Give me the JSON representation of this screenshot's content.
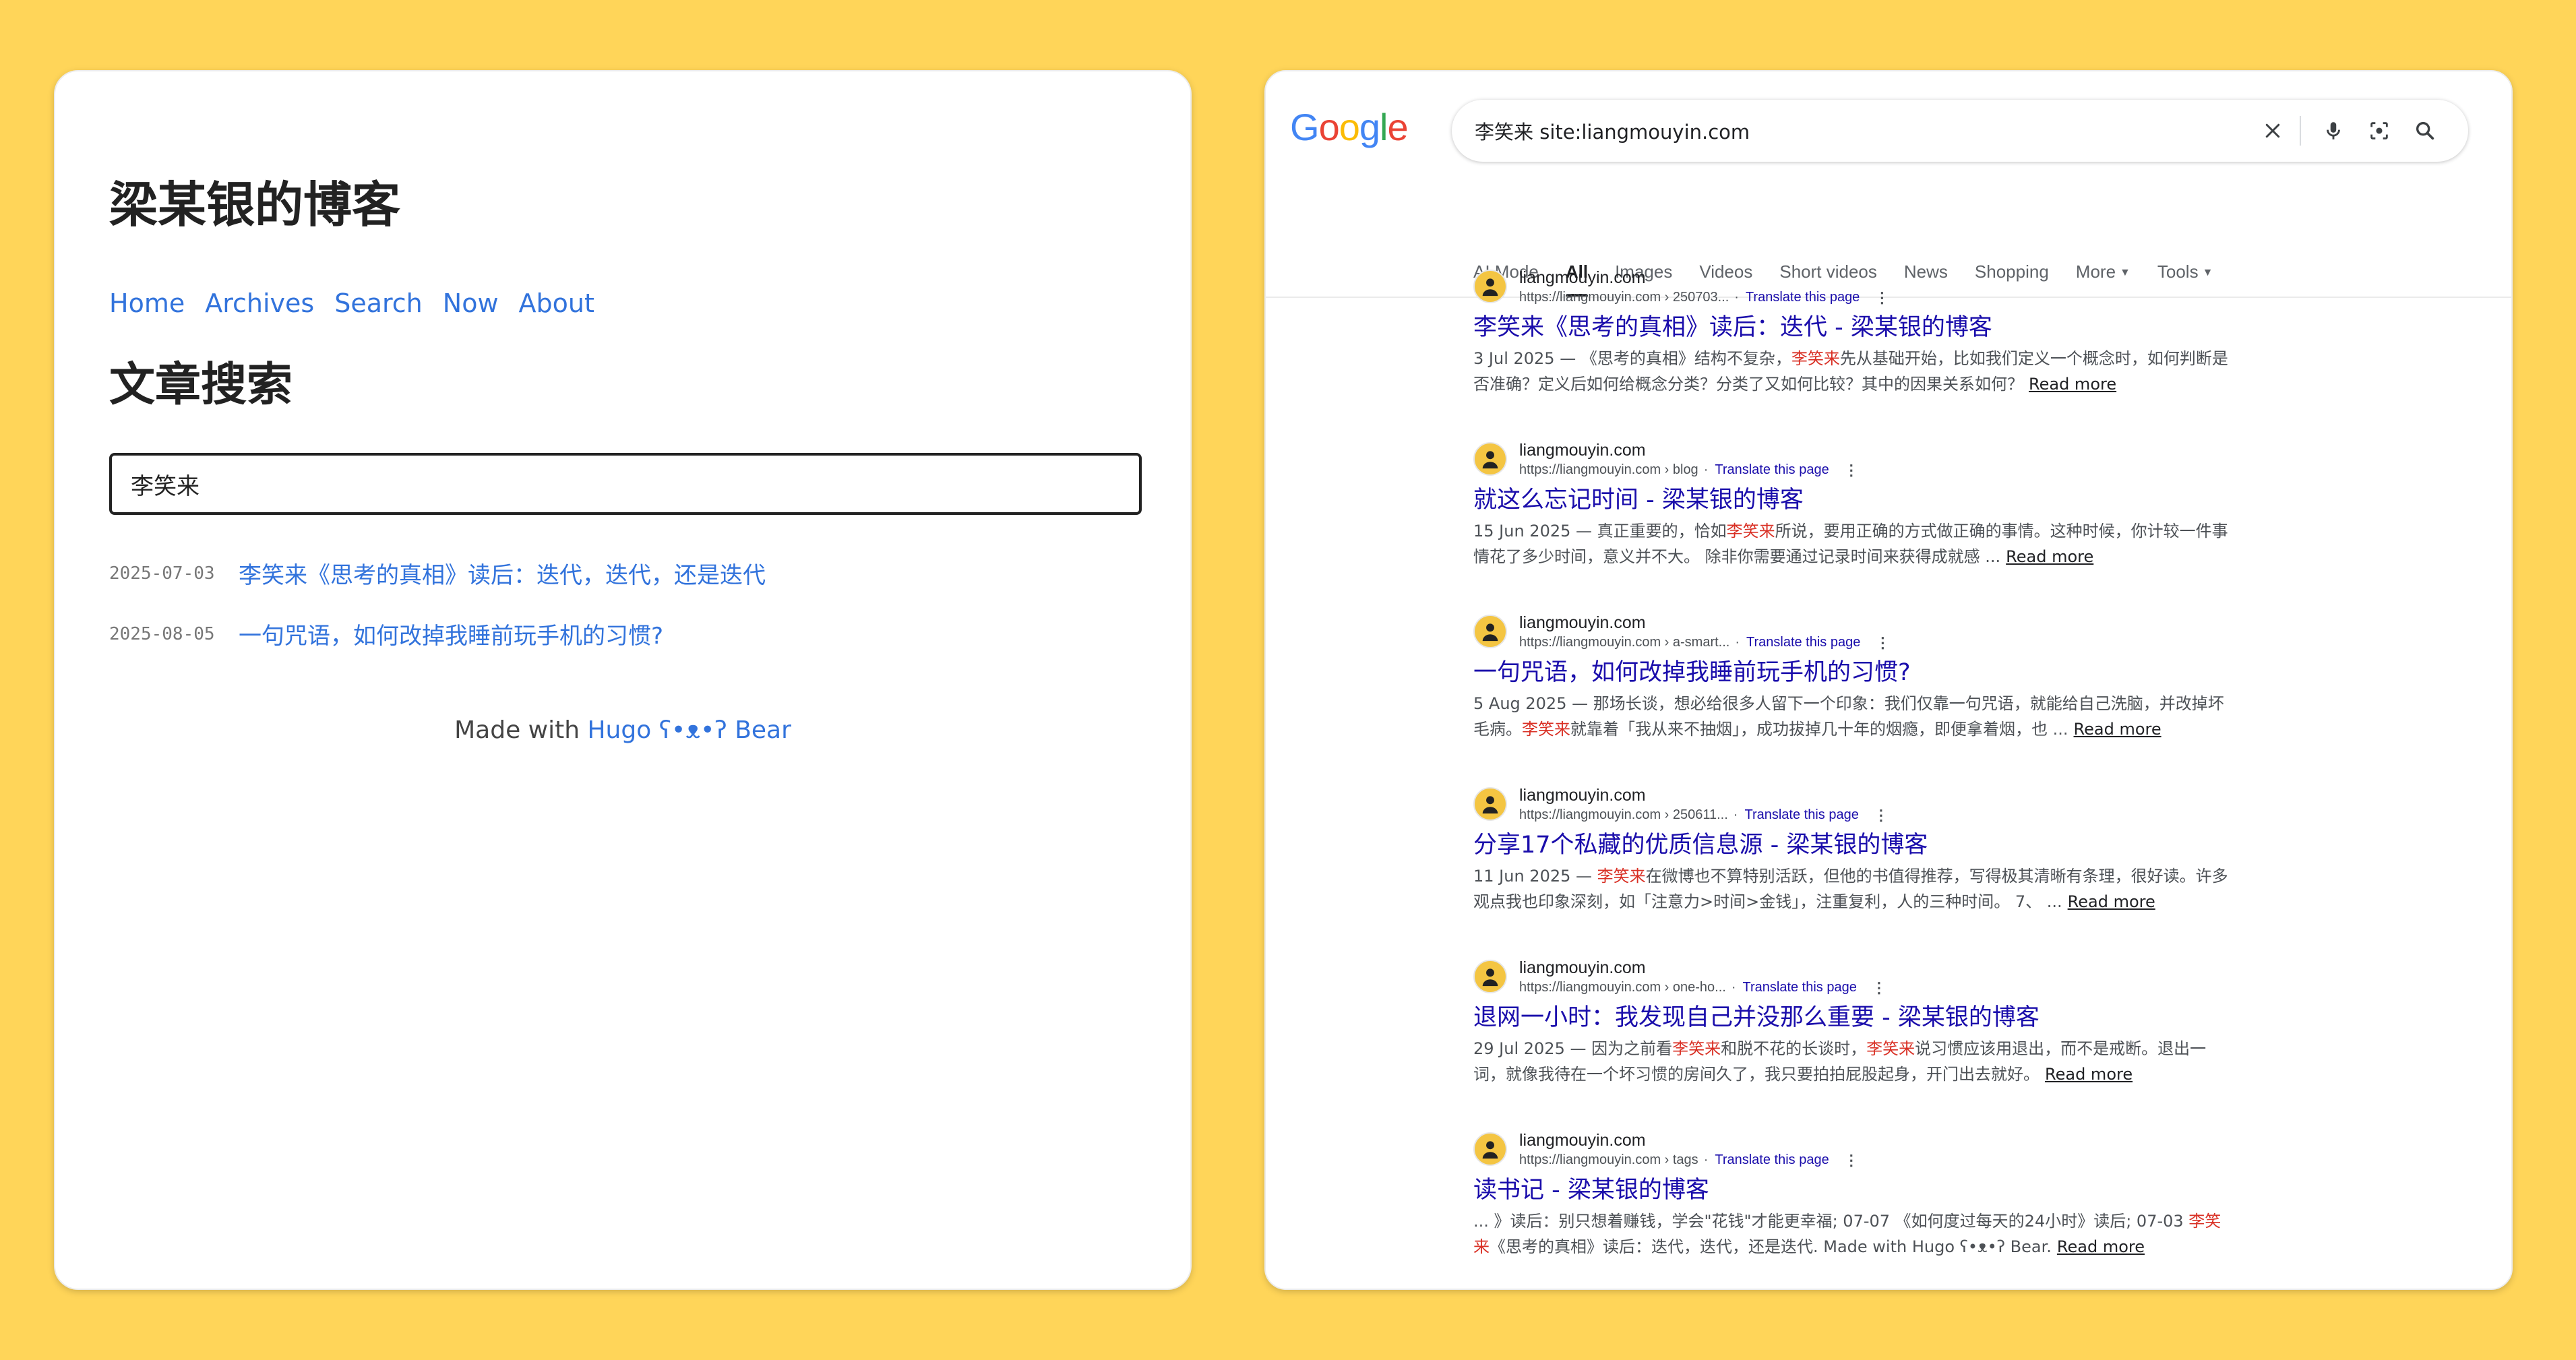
{
  "blog": {
    "title": "梁某银的博客",
    "nav": [
      "Home",
      "Archives",
      "Search",
      "Now",
      "About"
    ],
    "heading": "文章搜索",
    "search_value": "李笑来",
    "posts": [
      {
        "date": "2025-07-03",
        "title": "李笑来《思考的真相》读后：迭代，迭代，还是迭代"
      },
      {
        "date": "2025-08-05",
        "title": "一句咒语，如何改掉我睡前玩手机的习惯?"
      }
    ],
    "footer_prefix": "Made with ",
    "footer_link": "Hugo ʕ•ᴥ•ʔ Bear"
  },
  "google": {
    "logo": "Google",
    "query": "李笑来 site:liangmouyin.com",
    "tabs": [
      "AI Mode",
      "All",
      "Images",
      "Videos",
      "Short videos",
      "News",
      "Shopping",
      "More",
      "Tools"
    ],
    "active_tab": "All",
    "translate_label": "Translate this page",
    "read_more": "Read more",
    "results": [
      {
        "site": "liangmouyin.com",
        "url": "https://liangmouyin.com › 250703...",
        "title": "李笑来《思考的真相》读后：迭代 - 梁某银的博客",
        "s1": "3 Jul 2025 — 《思考的真相》结构不复杂，",
        "em1": "李笑来",
        "s2": "先从基础开始，比如我们定义一个概念时，如何判断是否准确？定义后如何给概念分类？分类了又如何比较？其中的因果关系如何？",
        "em2": "",
        "s3": ""
      },
      {
        "site": "liangmouyin.com",
        "url": "https://liangmouyin.com › blog",
        "title": "就这么忘记时间 - 梁某银的博客",
        "s1": "15 Jun 2025 — 真正重要的，恰如",
        "em1": "李笑来",
        "s2": "所说，要用正确的方式做正确的事情。这种时候，你计较一件事情花了多少时间，意义并不大。 除非你需要通过记录时间来获得成就感 ...",
        "em2": "",
        "s3": ""
      },
      {
        "site": "liangmouyin.com",
        "url": "https://liangmouyin.com › a-smart...",
        "title": "一句咒语，如何改掉我睡前玩手机的习惯?",
        "s1": "5 Aug 2025 — 那场长谈，想必给很多人留下一个印象：我们仅靠一句咒语，就能给自己洗脑，并改掉坏毛病。",
        "em1": "李笑来",
        "s2": "就靠着「我从来不抽烟」，成功拔掉几十年的烟瘾，即便拿着烟，也 ...",
        "em2": "",
        "s3": ""
      },
      {
        "site": "liangmouyin.com",
        "url": "https://liangmouyin.com › 250611...",
        "title": "分享17个私藏的优质信息源 - 梁某银的博客",
        "s1": "11 Jun 2025 — ",
        "em1": "李笑来",
        "s2": "在微博也不算特别活跃，但他的书值得推荐，写得极其清晰有条理，很好读。许多观点我也印象深刻，如「注意力>时间>金钱」，注重复利，人的三种时间。 7、 ...",
        "em2": "",
        "s3": ""
      },
      {
        "site": "liangmouyin.com",
        "url": "https://liangmouyin.com › one-ho...",
        "title": "退网一小时：我发现自己并没那么重要 - 梁某银的博客",
        "s1": "29 Jul 2025 — 因为之前看",
        "em1": "李笑来",
        "s2": "和脱不花的长谈时，",
        "em2": "李笑来",
        "s3": "说习惯应该用退出，而不是戒断。退出一词，就像我待在一个坏习惯的房间久了，我只要拍拍屁股起身，开门出去就好。"
      },
      {
        "site": "liangmouyin.com",
        "url": "https://liangmouyin.com › tags",
        "title": "读书记 - 梁某银的博客",
        "s1": "... 》读后：别只想着赚钱，学会\"花钱\"才能更幸福; 07-07 《如何度过每天的24小时》读后; 07-03 ",
        "em1": "李笑来",
        "s2": "《思考的真相》读后：迭代，迭代，还是迭代. Made with Hugo ʕ•ᴥ•ʔ Bear.",
        "em2": "",
        "s3": ""
      }
    ],
    "colors": {
      "link": "#1a0dab",
      "highlight": "#d93025",
      "g_blue": "#4285f4",
      "g_red": "#ea4335",
      "g_yellow": "#fbbc05",
      "g_green": "#34a853"
    }
  },
  "background_color": "#ffd559"
}
